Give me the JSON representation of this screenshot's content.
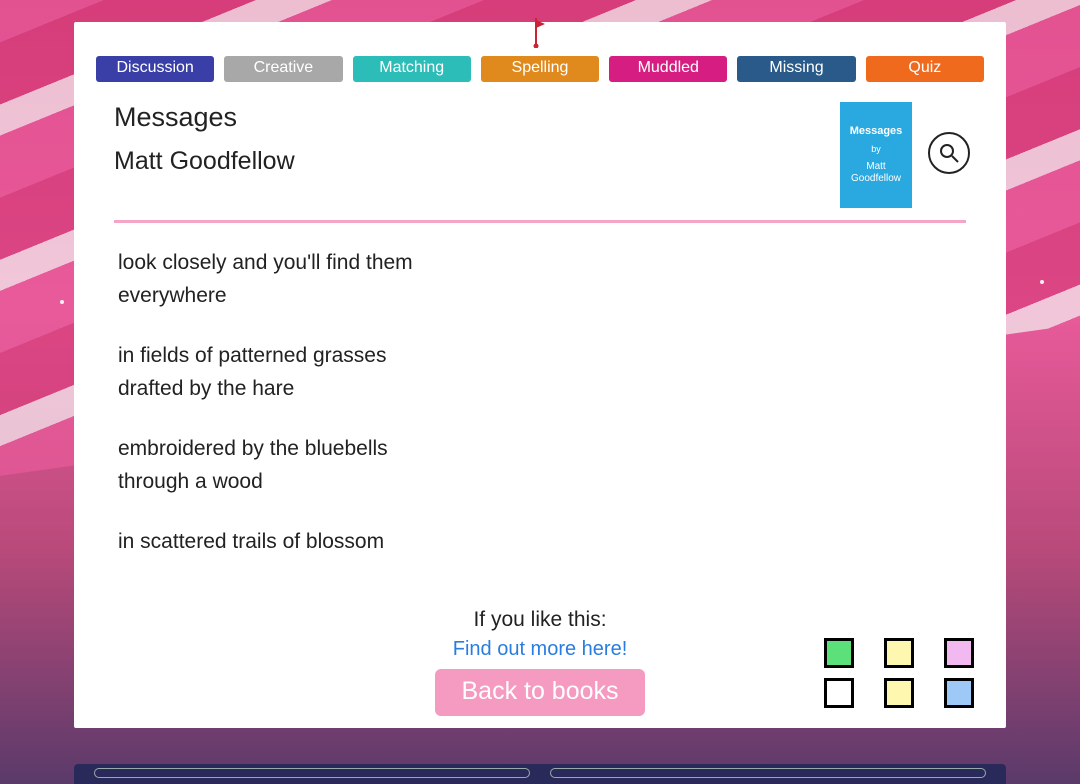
{
  "tabs": [
    {
      "label": "Discussion",
      "color": "#3a3fa8"
    },
    {
      "label": "Creative",
      "color": "#a8a8a8"
    },
    {
      "label": "Matching",
      "color": "#2dbdb8"
    },
    {
      "label": "Spelling",
      "color": "#e08a1e"
    },
    {
      "label": "Muddled",
      "color": "#d61e82"
    },
    {
      "label": "Missing",
      "color": "#2a5a8a"
    },
    {
      "label": "Quiz",
      "color": "#f06a1e"
    }
  ],
  "poem": {
    "title": "Messages",
    "author": "Matt Goodfellow",
    "thumb": {
      "title": "Messages",
      "by": "by",
      "author": "Matt Goodfellow"
    },
    "stanzas": [
      [
        "look closely and you'll find them",
        "everywhere"
      ],
      [
        "in fields of patterned grasses",
        "drafted by the hare"
      ],
      [
        "embroidered by the bluebells",
        "through a wood"
      ],
      [
        "in scattered trails of blossom"
      ]
    ]
  },
  "footer": {
    "like_label": "If you like this:",
    "find_link": "Find out more here!",
    "back_label": "Back to books"
  },
  "swatches": [
    "#5ce07a",
    "#fdf7b0",
    "#f2b8f0",
    "#ffffff",
    "#fdf7b0",
    "#9ec8f5"
  ]
}
